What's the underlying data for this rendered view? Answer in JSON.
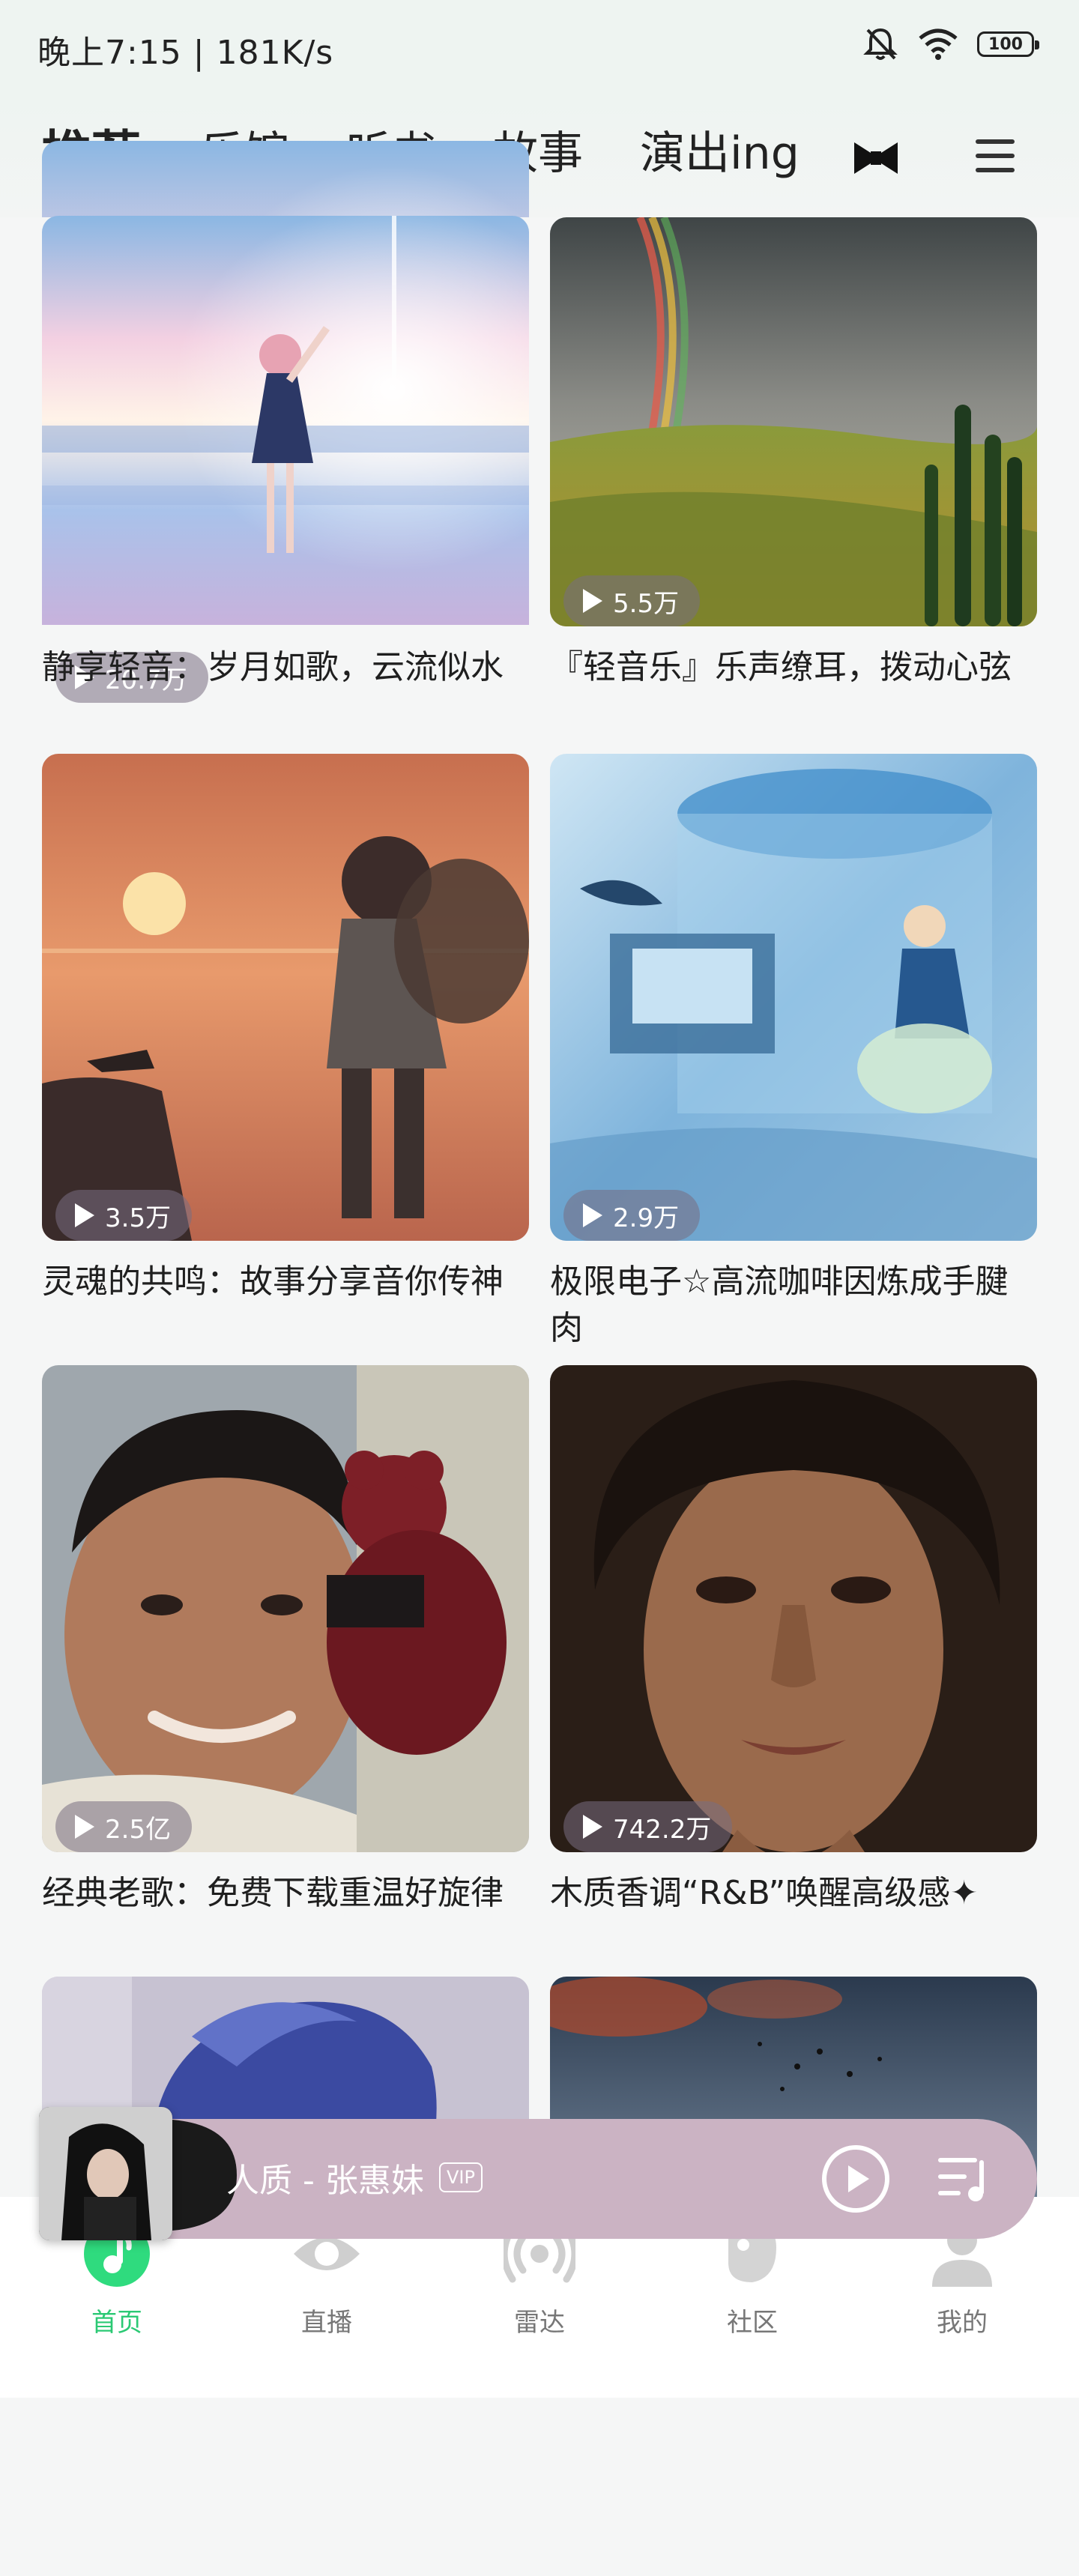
{
  "status_bar": {
    "time_speed": "晚上7:15 | 181K/s",
    "battery": "100"
  },
  "top_tabs": [
    {
      "label": "推荐",
      "active": true
    },
    {
      "label": "乐馆",
      "active": false
    },
    {
      "label": "听书",
      "active": false
    },
    {
      "label": "故事",
      "active": false
    },
    {
      "label": "演出ing",
      "active": false
    }
  ],
  "cards": [
    {
      "title": "静享轻音：岁月如歌，云流似水",
      "plays": "20.7万",
      "art": "anime-sunset-girl"
    },
    {
      "title": "『轻音乐』乐声缭耳，拨动心弦",
      "plays": "5.5万",
      "art": "rainbow-hills"
    },
    {
      "title": "灵魂的共鸣：故事分享音你传神",
      "plays": "3.5万",
      "art": "sunset-fisherman"
    },
    {
      "title": "极限电子☆高流咖啡因炼成手腱肉",
      "plays": "2.9万",
      "art": "underwater-room"
    },
    {
      "title": "经典老歌：免费下载重温好旋律",
      "plays": "2.5亿",
      "art": "man-with-bear"
    },
    {
      "title": "木质香调“R&B”唤醒高级感✦",
      "plays": "742.2万",
      "art": "portrait-curly-hair"
    },
    {
      "title": "",
      "plays": "",
      "art": "blue-hair-character"
    },
    {
      "title": "",
      "plays": "",
      "art": "dusk-birds-sky"
    }
  ],
  "mini_player": {
    "title": "人质 - 张惠妹",
    "badge": "VIP"
  },
  "bottom_nav": [
    {
      "label": "首页",
      "icon": "music-note-icon",
      "active": true
    },
    {
      "label": "直播",
      "icon": "eye-icon",
      "active": false
    },
    {
      "label": "雷达",
      "icon": "radar-icon",
      "active": false
    },
    {
      "label": "社区",
      "icon": "community-icon",
      "active": false
    },
    {
      "label": "我的",
      "icon": "profile-icon",
      "active": false
    }
  ],
  "colors": {
    "accent": "#2fdb7e",
    "mini_player_bg": "#cbb3c3"
  }
}
